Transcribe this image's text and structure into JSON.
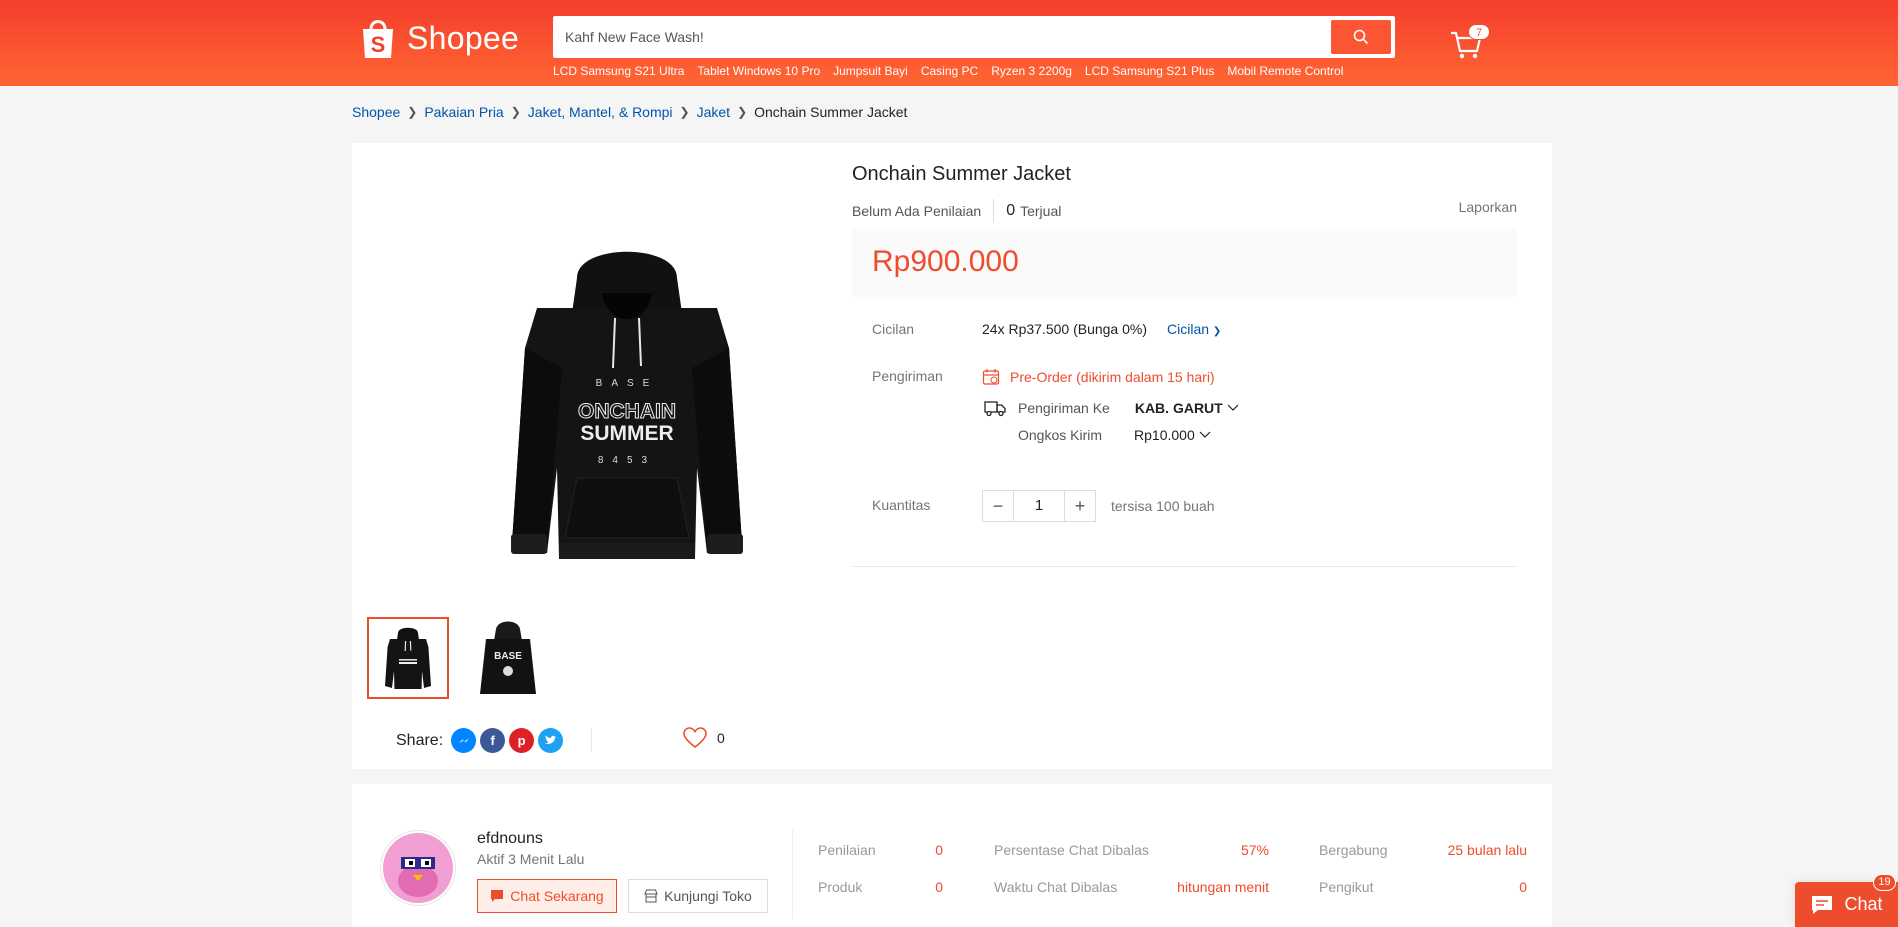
{
  "header": {
    "logo_text": "Shopee",
    "search_placeholder": "Kahf New Face Wash!",
    "suggestions": [
      "LCD Samsung S21 Ultra",
      "Tablet Windows 10 Pro",
      "Jumpsuit Bayi",
      "Casing PC",
      "Ryzen 3 2200g",
      "LCD Samsung S21 Plus",
      "Mobil Remote Control"
    ],
    "cart_count": "7",
    "brand_color": "#ee4d2d"
  },
  "breadcrumb": [
    "Shopee",
    "Pakaian Pria",
    "Jaket, Mantel, & Rompi",
    "Jaket",
    "Onchain Summer Jacket"
  ],
  "product": {
    "title": "Onchain Summer Jacket",
    "rating_text": "Belum Ada Penilaian",
    "sold_count": "0",
    "sold_label": "Terjual",
    "report_label": "Laporkan",
    "price": "Rp900.000",
    "cicilan_label": "Cicilan",
    "cicilan_value": "24x Rp37.500 (Bunga 0%)",
    "cicilan_link": "Cicilan",
    "shipping_label": "Pengiriman",
    "preorder_text": "Pre-Order (dikirim dalam 15 hari)",
    "ship_to_label": "Pengiriman Ke",
    "ship_to_value": "KAB. GARUT",
    "ongkos_label": "Ongkos Kirim",
    "ongkos_value": "Rp10.000",
    "qty_label": "Kuantitas",
    "qty_value": "1",
    "qty_minus": "−",
    "qty_plus": "+",
    "stock_text": "tersisa 100 buah",
    "print_top": "BASE",
    "print_line1": "ONCHAIN",
    "print_line2": "SUMMER",
    "print_bottom": "8453",
    "thumb2_text": "BASE",
    "share_label": "Share:",
    "like_count": "0"
  },
  "shop": {
    "name": "efdnouns",
    "active": "Aktif 3 Menit Lalu",
    "chat_button": "Chat Sekarang",
    "visit_button": "Kunjungi Toko",
    "stats": [
      {
        "label": "Penilaian",
        "value": "0"
      },
      {
        "label": "Produk",
        "value": "0"
      },
      {
        "label": "Persentase Chat Dibalas",
        "value": "57%"
      },
      {
        "label": "Waktu Chat Dibalas",
        "value": "hitungan menit"
      },
      {
        "label": "Bergabung",
        "value": "25 bulan lalu"
      },
      {
        "label": "Pengikut",
        "value": "0"
      }
    ]
  },
  "chat_widget": {
    "label": "Chat",
    "badge": "19"
  }
}
